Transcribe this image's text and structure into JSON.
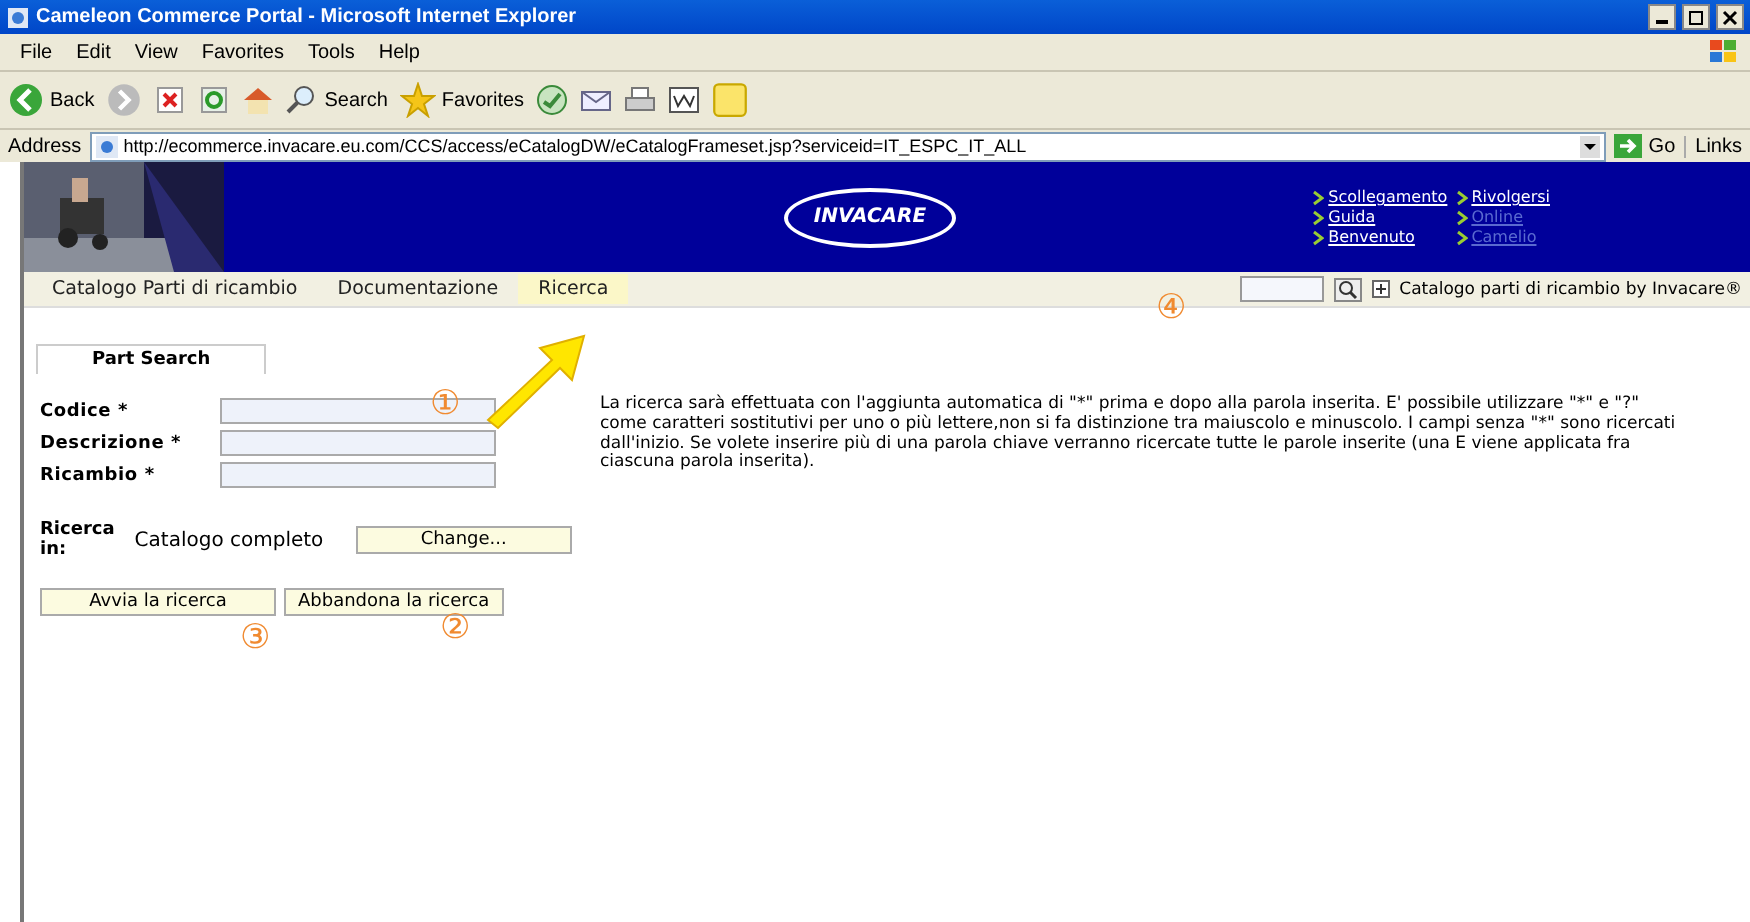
{
  "window": {
    "title": "Cameleon Commerce Portal - Microsoft Internet Explorer"
  },
  "menu": [
    "File",
    "Edit",
    "View",
    "Favorites",
    "Tools",
    "Help"
  ],
  "toolbar": {
    "back": "Back",
    "search": "Search",
    "favorites": "Favorites"
  },
  "address_bar": {
    "label": "Address",
    "url": "http://ecommerce.invacare.eu.com/CCS/access/eCatalogDW/eCatalogFrameset.jsp?serviceid=IT_ESPC_IT_ALL",
    "go": "Go",
    "links": "Links"
  },
  "header": {
    "logo": "INVACARE",
    "links": [
      {
        "label": "Scollegamento",
        "disabled": false
      },
      {
        "label": "Rivolgersi",
        "disabled": false
      },
      {
        "label": "Guida",
        "disabled": false
      },
      {
        "label": "Online",
        "disabled": true
      },
      {
        "label": "Benvenuto",
        "disabled": false
      },
      {
        "label": "Camelio",
        "disabled": true
      }
    ]
  },
  "nav": {
    "tabs": [
      {
        "label": "Catalogo Parti di ricambio",
        "selected": false
      },
      {
        "label": "Documentazione",
        "selected": false
      },
      {
        "label": "Ricerca",
        "selected": true
      }
    ],
    "brand": "Catalogo parti di ricambio by Invacare®"
  },
  "form": {
    "tab": "Part Search",
    "fields": [
      {
        "label": "Codice",
        "required": "*"
      },
      {
        "label": "Descrizione",
        "required": "*"
      },
      {
        "label": "Ricambio",
        "required": "*"
      }
    ],
    "scope_label": "Ricerca in:",
    "scope": "Catalogo completo",
    "change": "Change...",
    "buttons": [
      "Avvia la ricerca",
      "Abbandona la ricerca"
    ]
  },
  "help_text": "La ricerca sarà effettuata con l'aggiunta automatica di \"*\" prima e dopo alla parola inserita. E' possibile utilizzare \"*\" e \"?\" come caratteri sostitutivi per uno o più lettere,non si fa distinzione tra maiuscolo e minuscolo. I campi senza \"*\" sono ricercati dall'inizio. Se volete inserire più di una parola chiave verranno ricercate tutte le parole inserite (una E viene applicata fra ciascuna parola inserita).",
  "annotations": [
    "①",
    "②",
    "③",
    "④"
  ]
}
